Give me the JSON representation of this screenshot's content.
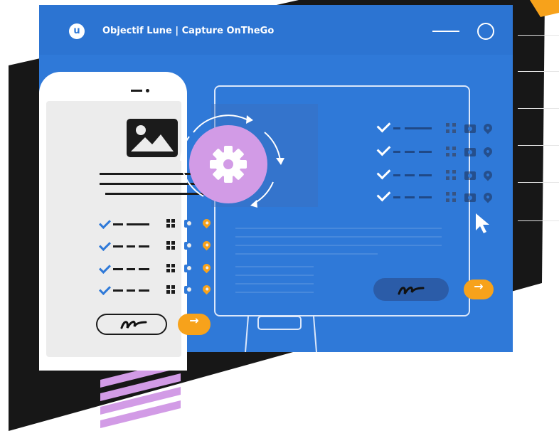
{
  "app": {
    "logo_letter": "u",
    "title": "Objectif Lune | Capture OnTheGo"
  },
  "controls": {
    "minimize_icon": "minus-line-icon",
    "circle_icon": "circle-outline-icon"
  },
  "icons": {
    "image": "image-icon",
    "gear": "gear-icon",
    "sync": "sync-arrows-icon",
    "check": "check-icon",
    "qr": "qr-code-icon",
    "camera": "camera-icon",
    "pin": "location-pin-icon",
    "signature": "signature-icon",
    "arrow_right": "arrow-right-icon",
    "cursor": "mouse-cursor-icon"
  },
  "buttons": {
    "next_symbol": "→"
  },
  "colors": {
    "window_blue": "#2f79d8",
    "orange_accent": "#f7a21b",
    "purple_accent": "#d29be6",
    "dark": "#1b1b1b"
  }
}
